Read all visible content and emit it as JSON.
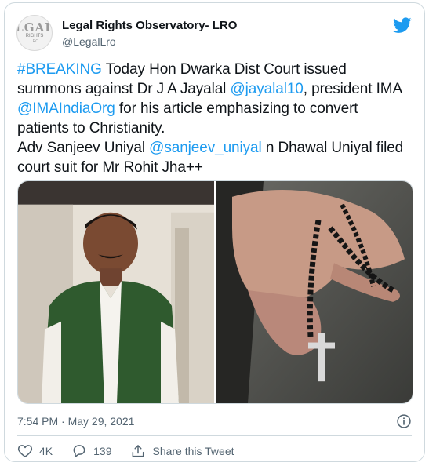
{
  "tweet": {
    "avatar_text": {
      "line1": "LGAL",
      "line2": "RIGHTS",
      "line3": "LRO"
    },
    "display_name": "Legal Rights Observatory- LRO",
    "handle": "@LegalLro",
    "text": {
      "hashtag": "#BREAKING",
      "p1": " Today Hon Dwarka Dist Court issued summons against Dr J A Jayalal ",
      "mention1": "@jayalal10",
      "p2": ", president IMA ",
      "mention2": "@IMAIndiaOrg",
      "p3": " for his article emphasizing to convert patients to Christianity.",
      "p4": "Adv Sanjeev Uniyal ",
      "mention3": "@sanjeev_uniyal",
      "p5": " n Dhawal Uniyal filed court suit for Mr Rohit Jha++"
    },
    "timestamp": "7:54 PM · May 29, 2021",
    "likes": "4K",
    "replies": "139",
    "share_label": "Share this Tweet",
    "colors": {
      "accent": "#1d9bf0",
      "secondary": "#536471",
      "border": "#cfd9de"
    },
    "icons": [
      "twitter-bird-icon",
      "info-icon",
      "heart-icon",
      "reply-icon",
      "share-icon"
    ]
  }
}
